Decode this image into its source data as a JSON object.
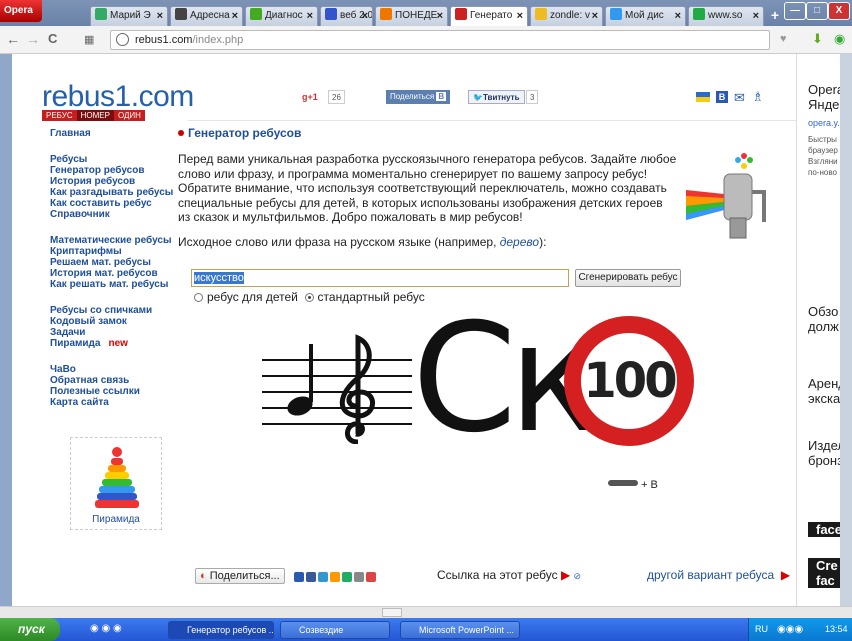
{
  "browser": {
    "opera_label": "Opera",
    "tabs": [
      {
        "label": "Марий Э",
        "color": "#3a6"
      },
      {
        "label": "Адресна",
        "color": "#444"
      },
      {
        "label": "Диагнос",
        "color": "#4a2"
      },
      {
        "label": "веб 2.0",
        "color": "#35c"
      },
      {
        "label": "ПОНЕДЕ",
        "color": "#e70"
      },
      {
        "label": "Генерато",
        "color": "#c22"
      },
      {
        "label": "zondle: v",
        "color": "#eb2"
      },
      {
        "label": "Мой дис",
        "color": "#39e"
      },
      {
        "label": "www.so",
        "color": "#2a4"
      }
    ],
    "url_domain": "rebus1.com",
    "url_path": "/index.php"
  },
  "site": {
    "logo": "rebus1.com",
    "logo_bar": [
      "РЕБУС",
      "НОМЕР",
      "ОДИН"
    ],
    "gplus": "g+1",
    "gplus_count": "26",
    "share_vk": "Поделиться",
    "tweet": "Твитнуть",
    "tweet_count": "3"
  },
  "nav": [
    {
      "label": "Главная"
    },
    {
      "label": "Ребусы"
    },
    {
      "label": "Генератор ребусов"
    },
    {
      "label": "История ребусов"
    },
    {
      "label": "Как разгадывать ребусы"
    },
    {
      "label": "Как составить ребус"
    },
    {
      "label": "Справочник"
    },
    {
      "label": "Математические ребусы"
    },
    {
      "label": "Криптарифмы"
    },
    {
      "label": "Решаем мат. ребусы"
    },
    {
      "label": "История мат. ребусов"
    },
    {
      "label": "Как решать мат. ребусы"
    },
    {
      "label": "Ребусы со спичками"
    },
    {
      "label": "Кодовый замок"
    },
    {
      "label": "Задачи"
    },
    {
      "label": "Пирамида",
      "badge": "new"
    },
    {
      "label": "ЧаВо"
    },
    {
      "label": "Обратная связь"
    },
    {
      "label": "Полезные ссылки"
    },
    {
      "label": "Карта сайта"
    }
  ],
  "main": {
    "title": "Генератор ребусов",
    "intro": "Перед вами уникальная разработка русскоязычного генератора ребусов. Задайте любое слово или фразу, и программа моментально сгенерирует по вашему запросу ребус! Обратите внимание, что используя соответствующий переключатель, можно создавать специальные ребусы для детей, в которых использованы изображения детских героев из сказок и мультфильмов. Добро пожаловать в мир ребусов!",
    "prompt_before": "Исходное слово или фраза на русском языке (например, ",
    "prompt_example": "дерево",
    "prompt_after": "):",
    "input_value": "искусство",
    "generate_button": "Сгенерировать ребус",
    "radio_kids": "ребус для детей",
    "radio_standard": "стандартный ребус",
    "rebus_letters": "Ск",
    "rebus_sign": "100",
    "rebus_hint": "+ В",
    "pyramid_label": "Пирамида",
    "share_label": "Поделиться...",
    "link_text": "Ссылка на этот ребус",
    "other_variant": "другой вариант ребуса"
  },
  "ads": [
    {
      "title": "Opera",
      "line2": "Яндек",
      "link": "opera.y.",
      "text": "Быстры браузер Взгляни по-ново"
    },
    {
      "title": "Обзо",
      "line2": "долж"
    },
    {
      "title": "Аренд",
      "line2": "экска"
    },
    {
      "title": "Издел",
      "line2": "бронз"
    },
    {
      "title": "face"
    },
    {
      "title": "Cre",
      "line2": "fac"
    }
  ],
  "taskbar": {
    "start": "пуск",
    "tasks": [
      "Генератор ребусов ...",
      "Созвездие",
      "Microsoft PowerPoint ..."
    ],
    "lang": "RU",
    "clock": "13:54"
  }
}
